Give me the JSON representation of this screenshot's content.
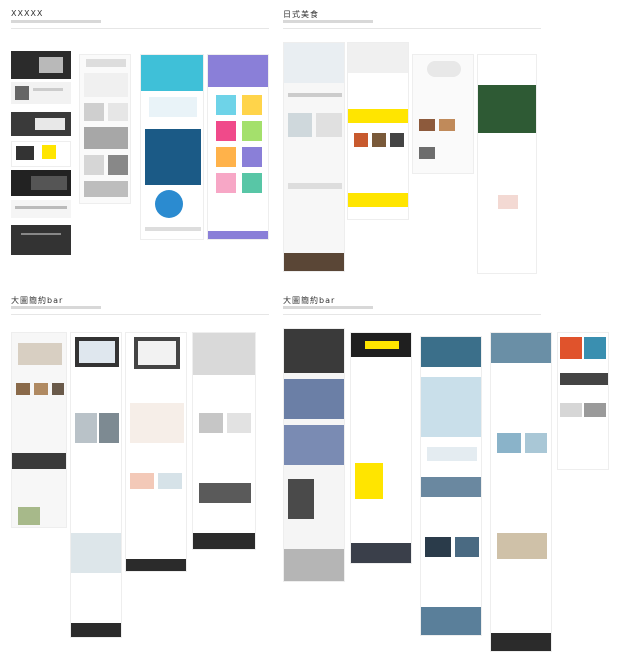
{
  "sections": [
    {
      "title": "XXXXX"
    },
    {
      "title": "日式美食"
    },
    {
      "title": "大圖簡約bar"
    },
    {
      "title": "大圖簡約bar"
    }
  ],
  "palette": {
    "yellow": "#ffe500",
    "dark": "#2b2b2b",
    "teal": "#3fc0d8",
    "navy": "#1b5a86",
    "purple": "#8a7fd8",
    "pink": "#f04a8a"
  }
}
